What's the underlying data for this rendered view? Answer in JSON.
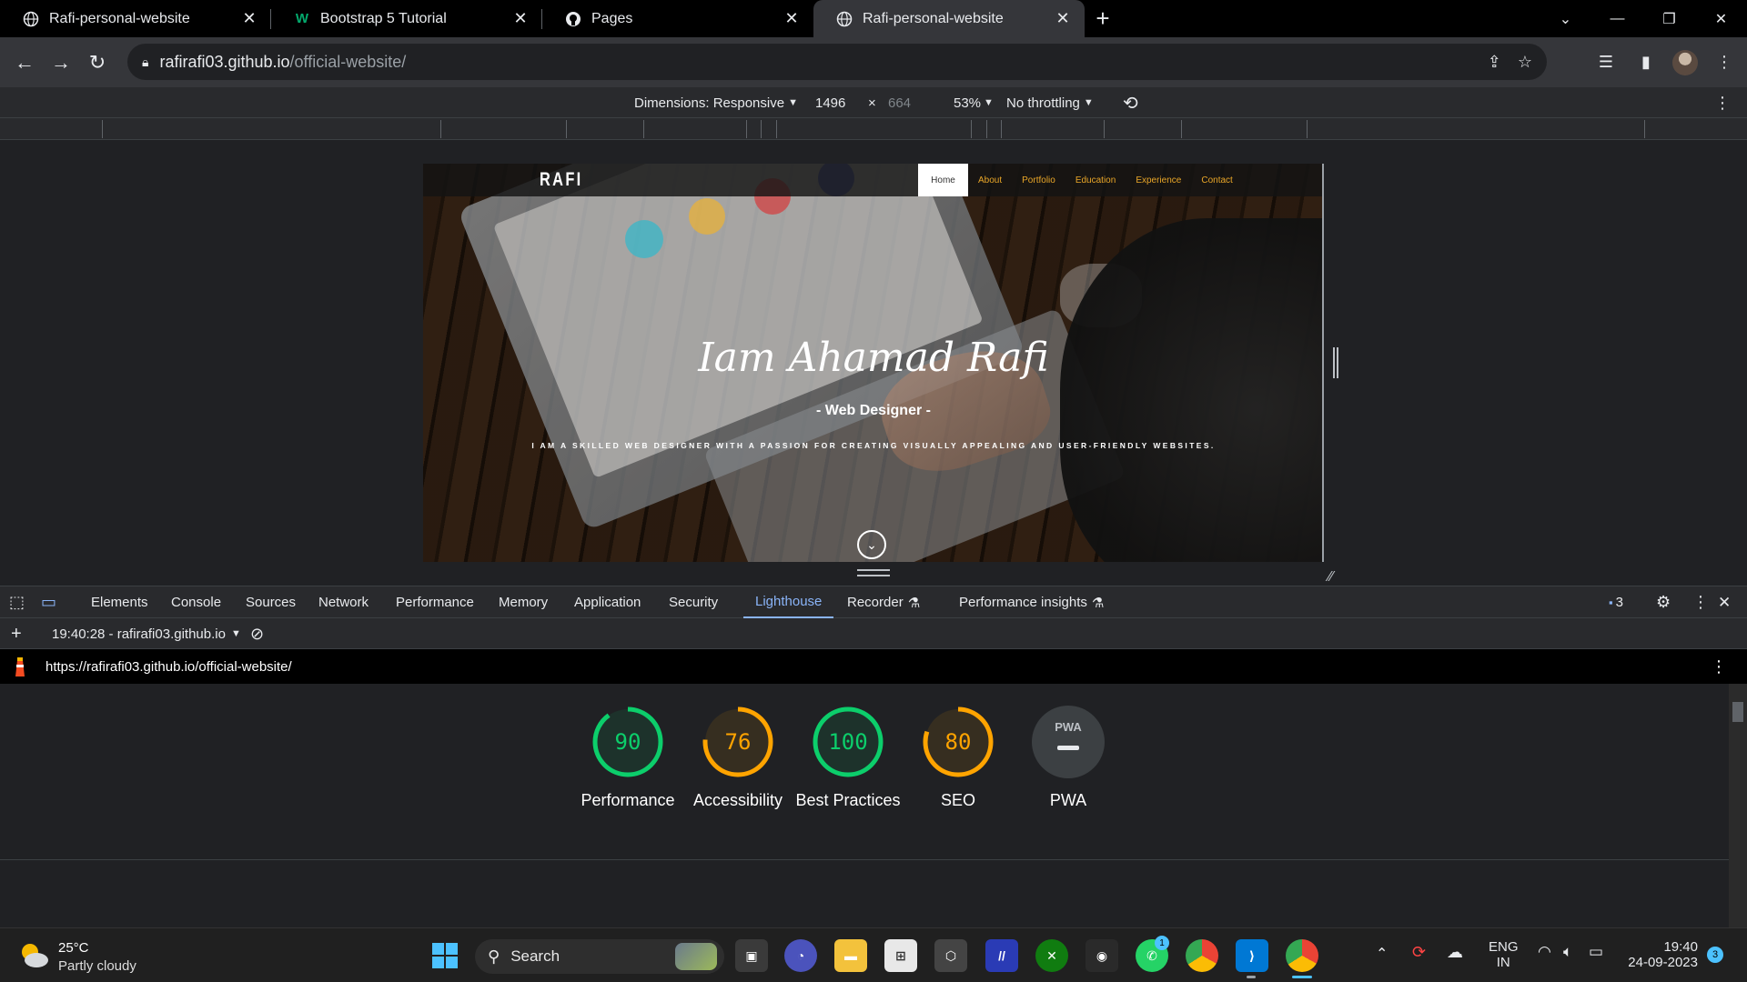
{
  "browser": {
    "tabs": [
      {
        "title": "Rafi-personal-website",
        "favicon": "globe-icon",
        "active": false
      },
      {
        "title": "Bootstrap 5 Tutorial",
        "favicon": "w3schools-icon",
        "active": false
      },
      {
        "title": "Pages",
        "favicon": "github-icon",
        "active": false
      },
      {
        "title": "Rafi-personal-website",
        "favicon": "globe-icon",
        "active": true
      }
    ],
    "address": {
      "host": "rafirafi03.github.io",
      "path": "/official-website/"
    }
  },
  "device_toolbar": {
    "dimensions_label": "Dimensions: Responsive",
    "width": "1496",
    "times": "×",
    "height": "664",
    "zoom": "53%",
    "throttling": "No throttling"
  },
  "site": {
    "brand": "RAFI",
    "nav": [
      "Home",
      "About",
      "Portfolio",
      "Education",
      "Experience",
      "Contact"
    ],
    "hero_name": "Iam Ahamad Rafi",
    "hero_role": "- Web Designer -",
    "hero_tagline": "I AM A SKILLED WEB DESIGNER WITH A PASSION FOR CREATING VISUALLY APPEALING AND USER-FRIENDLY WEBSITES."
  },
  "devtools": {
    "tabs": [
      "Elements",
      "Console",
      "Sources",
      "Network",
      "Performance",
      "Memory",
      "Application",
      "Security",
      "Lighthouse",
      "Recorder",
      "Performance insights"
    ],
    "active_tab": "Lighthouse",
    "issues_count": "3",
    "report_selector": "19:40:28 - rafirafi03.github.io",
    "report_url": "https://rafirafi03.github.io/official-website/"
  },
  "lighthouse": {
    "scores": [
      {
        "label": "Performance",
        "value": "90",
        "fraction": 0.9,
        "color": "#0cce6b"
      },
      {
        "label": "Accessibility",
        "value": "76",
        "fraction": 0.76,
        "color": "#ffa400"
      },
      {
        "label": "Best Practices",
        "value": "100",
        "fraction": 1.0,
        "color": "#0cce6b"
      },
      {
        "label": "SEO",
        "value": "80",
        "fraction": 0.8,
        "color": "#ffa400"
      }
    ],
    "pwa": {
      "label": "PWA",
      "badge": "PWA"
    }
  },
  "taskbar": {
    "weather_temp": "25°C",
    "weather_desc": "Partly cloudy",
    "search_label": "Search",
    "lang": "ENG",
    "region": "IN",
    "time": "19:40",
    "date": "24-09-2023",
    "notifications": "3",
    "whatsapp_badge": "1"
  }
}
